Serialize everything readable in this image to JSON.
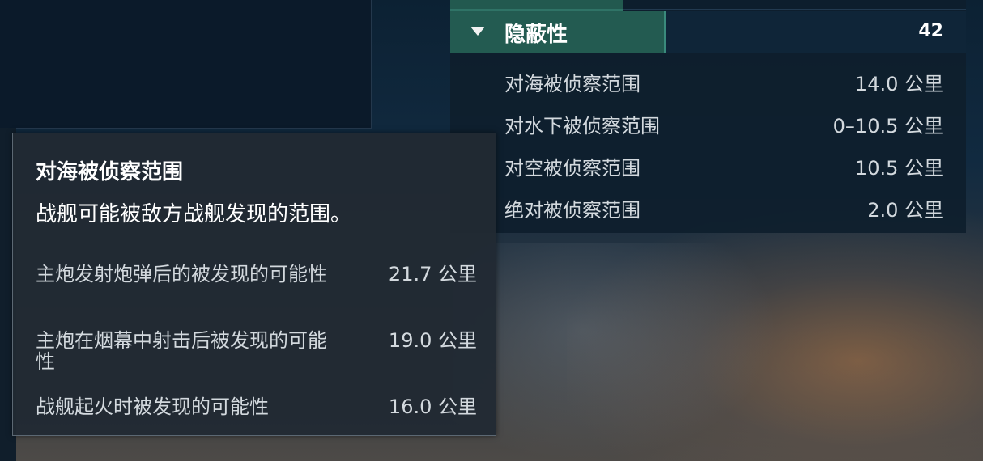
{
  "stats": {
    "category": {
      "label": "隐蔽性",
      "value": "42",
      "icon": "triangle-down-icon",
      "accent": "#235b51"
    },
    "rows": [
      {
        "label": "对海被侦察范围",
        "value": "14.0 公里"
      },
      {
        "label": "对水下被侦察范围",
        "value": "0–10.5 公里"
      },
      {
        "label": "对空被侦察范围",
        "value": "10.5 公里"
      },
      {
        "label": "绝对被侦察范围",
        "value": "2.0 公里"
      }
    ]
  },
  "tooltip": {
    "title": "对海被侦察范围",
    "description": "战舰可能被敌方战舰发现的范围。",
    "rows": [
      {
        "label": "主炮发射炮弹后的被发现的可能性",
        "value": "21.7 公里"
      },
      {
        "label": "主炮在烟幕中射击后被发现的可能性",
        "value": "19.0 公里"
      },
      {
        "label": "战舰起火时被发现的可能性",
        "value": "16.0 公里"
      }
    ]
  }
}
